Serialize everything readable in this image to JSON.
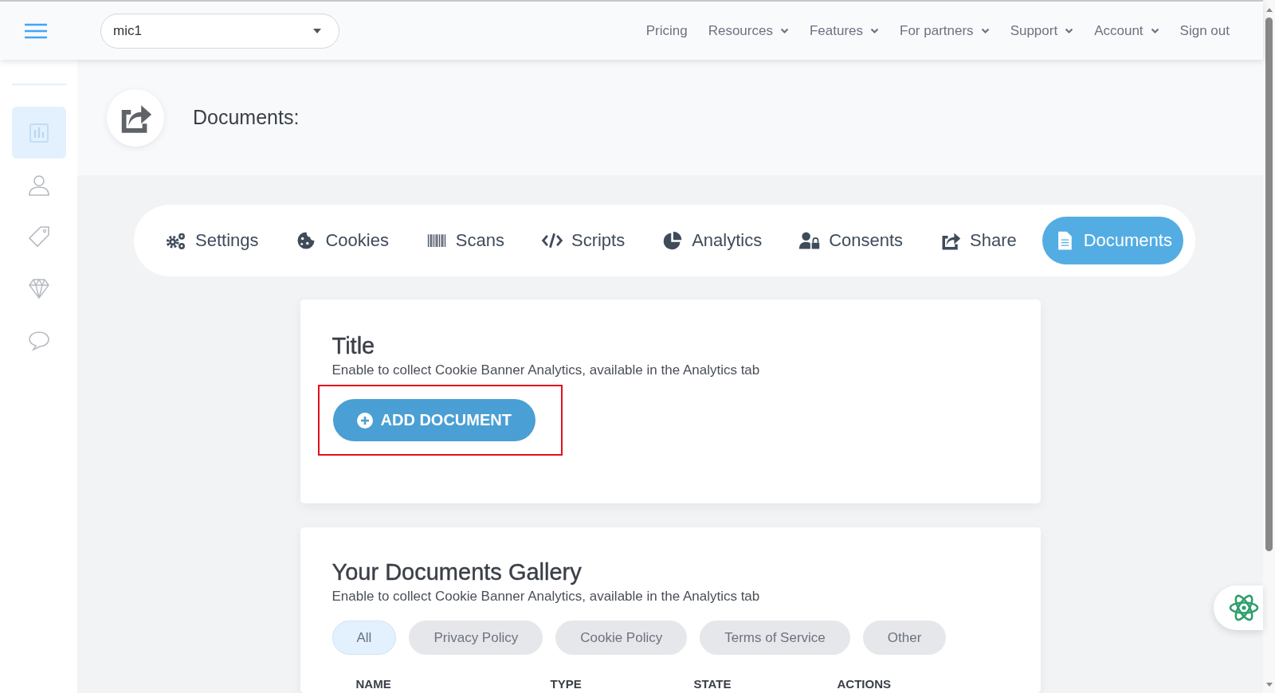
{
  "header": {
    "site_select": {
      "value": "mic1"
    },
    "nav": [
      {
        "label": "Pricing",
        "has_menu": false
      },
      {
        "label": "Resources",
        "has_menu": true
      },
      {
        "label": "Features",
        "has_menu": true
      },
      {
        "label": "For partners",
        "has_menu": true
      },
      {
        "label": "Support",
        "has_menu": true
      },
      {
        "label": "Account",
        "has_menu": true
      },
      {
        "label": "Sign out",
        "has_menu": false
      }
    ]
  },
  "sidebar": {
    "items": [
      {
        "selected": true
      },
      {
        "selected": false
      },
      {
        "selected": false
      },
      {
        "selected": false
      },
      {
        "selected": false
      }
    ]
  },
  "page_title": "Documents:",
  "tabs": [
    {
      "label": "Settings",
      "selected": false
    },
    {
      "label": "Cookies",
      "selected": false
    },
    {
      "label": "Scans",
      "selected": false
    },
    {
      "label": "Scripts",
      "selected": false
    },
    {
      "label": "Analytics",
      "selected": false
    },
    {
      "label": "Consents",
      "selected": false
    },
    {
      "label": "Share",
      "selected": false
    },
    {
      "label": "Documents",
      "selected": true
    }
  ],
  "add_card": {
    "title": "Title",
    "description": "Enable to collect Cookie Banner Analytics, available in the Analytics tab",
    "button": "ADD DOCUMENT"
  },
  "gallery": {
    "title": "Your Documents Gallery",
    "description": "Enable to collect Cookie Banner Analytics, available in the Analytics tab",
    "filters": [
      {
        "label": "All",
        "selected": true
      },
      {
        "label": "Privacy Policy",
        "selected": false
      },
      {
        "label": "Cookie Policy",
        "selected": false
      },
      {
        "label": "Terms of Service",
        "selected": false
      },
      {
        "label": "Other",
        "selected": false
      }
    ],
    "table": {
      "columns": [
        "NAME",
        "TYPE",
        "STATE",
        "ACTIONS"
      ]
    }
  }
}
